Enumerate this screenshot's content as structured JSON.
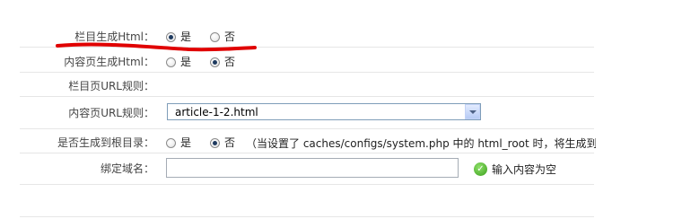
{
  "settings": {
    "category_html": {
      "label": "栏目生成Html：",
      "options": [
        "是",
        "否"
      ],
      "selected": "是"
    },
    "content_html": {
      "label": "内容页生成Html：",
      "options": [
        "是",
        "否"
      ],
      "selected": "否"
    },
    "category_url_rule": {
      "label": "栏目页URL规则："
    },
    "content_url_rule": {
      "label": "内容页URL规则：",
      "value": "article-1-2.html"
    },
    "root_generate": {
      "label": "是否生成到根目录：",
      "options": [
        "是",
        "否"
      ],
      "selected": "否",
      "note": "（当设置了 caches/configs/system.php 中的 html_root 时，将生成到该目"
    },
    "bind_domain": {
      "label": "绑定域名：",
      "value": "",
      "hint": "输入内容为空"
    }
  },
  "colors": {
    "annotation_underline": "#e00000",
    "hint_check": "#3a9f1c"
  },
  "icons": {
    "hint": "check-circle-icon",
    "select": "chevron-down-icon"
  }
}
